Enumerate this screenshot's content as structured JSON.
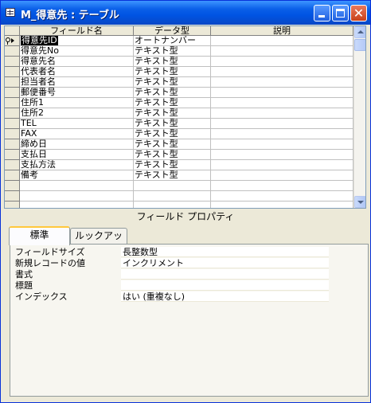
{
  "window": {
    "title": "M_得意先 : テーブル",
    "buttons": {
      "minimize": "minimize-icon",
      "maximize": "maximize-icon",
      "close": "close-icon",
      "close_glyph": "✕"
    }
  },
  "grid": {
    "headers": [
      "フィールド名",
      "データ型",
      "説明"
    ],
    "rows": [
      {
        "name": "得意先ID",
        "type": "オートナンバー",
        "desc": ""
      },
      {
        "name": "得意先No",
        "type": "テキスト型",
        "desc": ""
      },
      {
        "name": "得意先名",
        "type": "テキスト型",
        "desc": ""
      },
      {
        "name": "代表者名",
        "type": "テキスト型",
        "desc": ""
      },
      {
        "name": "担当者名",
        "type": "テキスト型",
        "desc": ""
      },
      {
        "name": "郵便番号",
        "type": "テキスト型",
        "desc": ""
      },
      {
        "name": "住所1",
        "type": "テキスト型",
        "desc": ""
      },
      {
        "name": "住所2",
        "type": "テキスト型",
        "desc": ""
      },
      {
        "name": "TEL",
        "type": "テキスト型",
        "desc": ""
      },
      {
        "name": "FAX",
        "type": "テキスト型",
        "desc": ""
      },
      {
        "name": "締め日",
        "type": "テキスト型",
        "desc": ""
      },
      {
        "name": "支払日",
        "type": "テキスト型",
        "desc": ""
      },
      {
        "name": "支払方法",
        "type": "テキスト型",
        "desc": ""
      },
      {
        "name": "備考",
        "type": "テキスト型",
        "desc": ""
      },
      {
        "name": "",
        "type": "",
        "desc": ""
      },
      {
        "name": "",
        "type": "",
        "desc": ""
      },
      {
        "name": "",
        "type": "",
        "desc": ""
      },
      {
        "name": "",
        "type": "",
        "desc": ""
      }
    ]
  },
  "properties": {
    "section_label": "フィールド プロパティ",
    "tabs": [
      "標準",
      "ルックアップ"
    ],
    "active_tab": "標準",
    "fields": [
      {
        "label": "フィールドサイズ",
        "value": "長整数型"
      },
      {
        "label": "新規レコードの値",
        "value": "インクリメント"
      },
      {
        "label": "書式",
        "value": ""
      },
      {
        "label": "標題",
        "value": ""
      },
      {
        "label": "インデックス",
        "value": "はい (重複なし)"
      }
    ]
  }
}
